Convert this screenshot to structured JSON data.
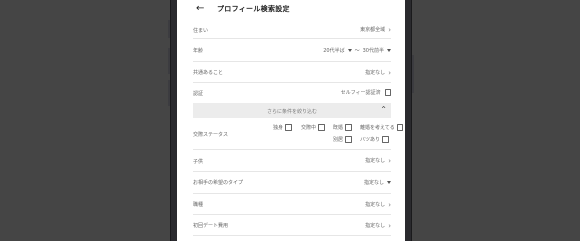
{
  "header": {
    "back_icon": "←",
    "title": "プロフィール検索設定"
  },
  "rows": {
    "residence": {
      "label": "住まい",
      "value": "東京都全域"
    },
    "age": {
      "label": "年齢",
      "from": "20代半ば",
      "sep": "〜",
      "to": "30代前半"
    },
    "common": {
      "label": "共通あること",
      "value": "指定なし"
    },
    "verification": {
      "label": "認証",
      "value": "セルフィー認証済"
    }
  },
  "filter_band": {
    "label": "さらに条件を絞り込む"
  },
  "marital": {
    "label": "交際ステータス",
    "options": [
      "独身",
      "交際中",
      "既婚",
      "離婚を考えてる",
      "別居",
      "バツあり"
    ]
  },
  "rows2": {
    "children": {
      "label": "子供",
      "value": "指定なし"
    },
    "preferred_type": {
      "label": "お相手の希望のタイプ",
      "value": "指定なし"
    },
    "occupation": {
      "label": "職種",
      "value": "指定なし"
    },
    "first_date_cost": {
      "label": "初回デート費用",
      "value": "指定なし"
    }
  },
  "icons": {
    "chevron_right": "›",
    "chevron_up": "⌃"
  }
}
